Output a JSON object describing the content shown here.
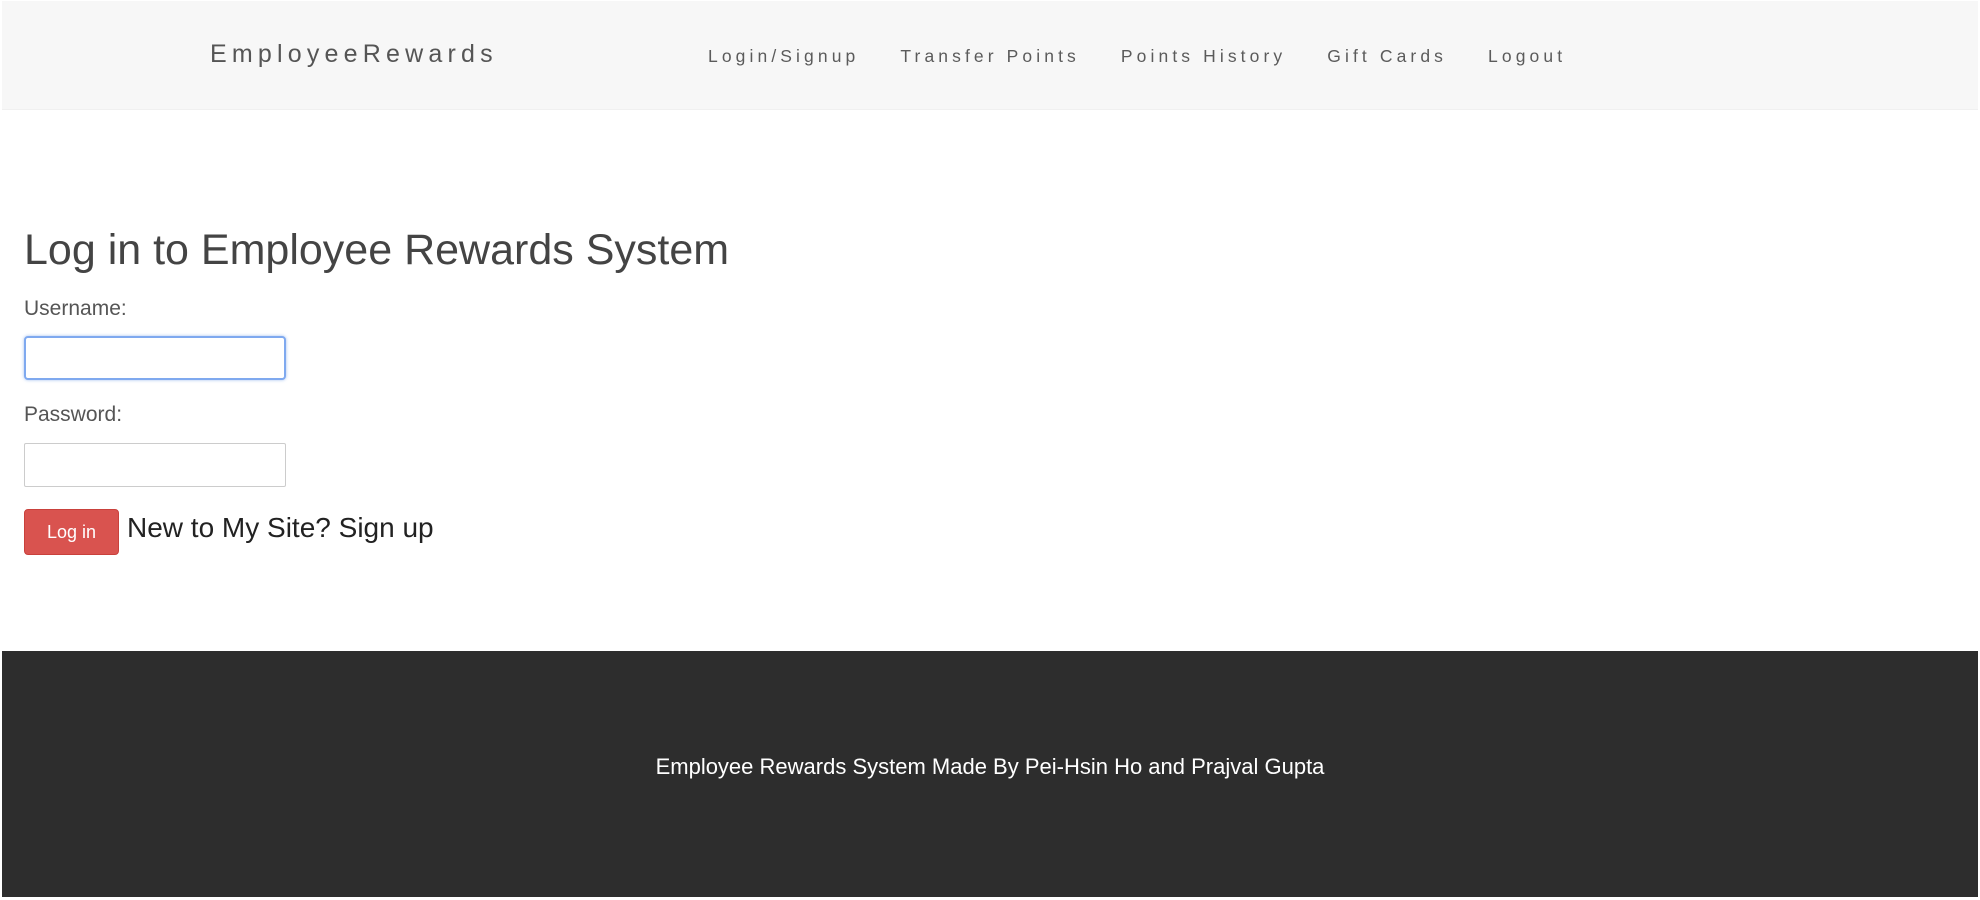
{
  "navbar": {
    "brand": "EmployeeRewards",
    "links": [
      {
        "label": "Login/Signup"
      },
      {
        "label": "Transfer Points"
      },
      {
        "label": "Points History"
      },
      {
        "label": "Gift Cards"
      },
      {
        "label": "Logout"
      }
    ]
  },
  "login_form": {
    "title": "Log in to Employee Rewards System",
    "username_label": "Username:",
    "username_value": "",
    "password_label": "Password:",
    "password_value": "",
    "submit_label": "Log in",
    "signup_prompt": "New to My Site?",
    "signup_link": "Sign up"
  },
  "footer": {
    "text": "Employee Rewards System Made By Pei-Hsin Ho and Prajval Gupta"
  },
  "colors": {
    "navbar_bg": "#f7f7f7",
    "login_button": "#d9534f",
    "focus_ring": "#7fa9ef",
    "footer_bg": "#2d2d2d"
  }
}
